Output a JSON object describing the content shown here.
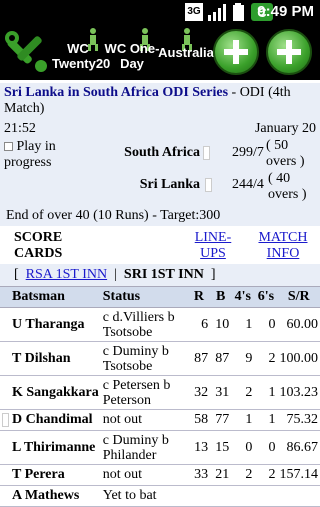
{
  "status_bar": {
    "time": "9:49 PM",
    "network": "3G"
  },
  "toolbar": {
    "tabs": [
      {
        "label": "WC Twenty20"
      },
      {
        "label": "WC One-Day"
      },
      {
        "label": "Australia"
      }
    ],
    "add_buttons": 2
  },
  "match": {
    "series": "Sri Lanka in South Africa ODI Series",
    "detail": " - ODI (4th Match)",
    "time": "21:52",
    "date": "January 20"
  },
  "score": {
    "status": "Play in progress",
    "teams": [
      {
        "name": "South Africa",
        "score": "299/7",
        "overs": "( 50 overs )"
      },
      {
        "name": "Sri Lanka",
        "score": "244/4",
        "overs": "( 40 overs )"
      }
    ]
  },
  "over_status": "End of over 40 (10 Runs) - Target:300",
  "nav": {
    "scorecards": "SCORE CARDS",
    "lineups": "LINE-UPS",
    "match_info": "MATCH INFO"
  },
  "innings": {
    "tab1": "RSA 1ST INN",
    "sep": "|",
    "tab2": "SRI 1ST INN"
  },
  "batting": {
    "headers": [
      "Batsman",
      "Status",
      "R",
      "B",
      "4's",
      "6's",
      "S/R"
    ],
    "rows": [
      {
        "name": "U Tharanga",
        "status": "c d.Villiers b Tsotsobe",
        "r": "6",
        "b": "10",
        "fours": "1",
        "sixes": "0",
        "sr": "60.00"
      },
      {
        "name": "T Dilshan",
        "status": "c Duminy b Tsotsobe",
        "r": "87",
        "b": "87",
        "fours": "9",
        "sixes": "2",
        "sr": "100.00"
      },
      {
        "name": "K Sangakkara",
        "status": "c Petersen b Peterson",
        "r": "32",
        "b": "31",
        "fours": "2",
        "sixes": "1",
        "sr": "103.23"
      },
      {
        "name": "D Chandimal",
        "status": "not out",
        "r": "58",
        "b": "77",
        "fours": "1",
        "sixes": "1",
        "sr": "75.32"
      },
      {
        "name": "L Thirimanne",
        "status": "c Duminy b Philander",
        "r": "13",
        "b": "15",
        "fours": "0",
        "sixes": "0",
        "sr": "86.67"
      },
      {
        "name": "T Perera",
        "status": "not out",
        "r": "33",
        "b": "21",
        "fours": "2",
        "sixes": "2",
        "sr": "157.14"
      },
      {
        "name": "A Mathews",
        "status": "Yet to bat",
        "r": "",
        "b": "",
        "fours": "",
        "sixes": "",
        "sr": ""
      }
    ]
  }
}
